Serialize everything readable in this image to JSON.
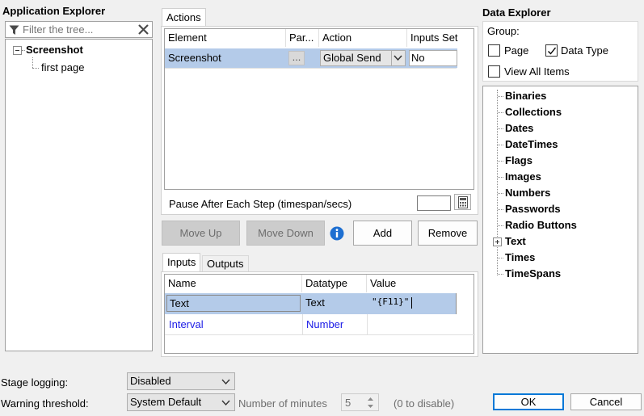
{
  "app_explorer": {
    "title": "Application Explorer",
    "filter_placeholder": "Filter the tree...",
    "tree": {
      "root": "Screenshot",
      "child": "first page"
    }
  },
  "tabs": {
    "actions": "Actions"
  },
  "actions_grid": {
    "headers": [
      "Element",
      "Par...",
      "Action",
      "Inputs Set"
    ],
    "row": {
      "element": "Screenshot",
      "params": "...",
      "action": "Global Send",
      "inputs_set": "No"
    }
  },
  "pause": {
    "label": "Pause After Each Step (timespan/secs)",
    "value": ""
  },
  "buttons": {
    "move_up": "Move Up",
    "move_down": "Move Down",
    "add": "Add",
    "remove": "Remove",
    "ok": "OK",
    "cancel": "Cancel"
  },
  "io_tabs": {
    "inputs": "Inputs",
    "outputs": "Outputs"
  },
  "inputs_grid": {
    "headers": [
      "Name",
      "Datatype",
      "Value"
    ],
    "rows": [
      {
        "name": "Text",
        "datatype": "Text",
        "value": "\"{F11}\""
      },
      {
        "name": "Interval",
        "datatype": "Number",
        "value": ""
      }
    ]
  },
  "data_explorer": {
    "title": "Data Explorer",
    "group_label": "Group:",
    "page_label": "Page",
    "page_checked": false,
    "data_type_label": "Data Type",
    "data_type_checked": true,
    "view_all_label": "View All Items",
    "view_all_checked": false,
    "items": [
      "Binaries",
      "Collections",
      "Dates",
      "DateTimes",
      "Flags",
      "Images",
      "Numbers",
      "Passwords",
      "Radio Buttons",
      "Text",
      "Times",
      "TimeSpans"
    ]
  },
  "footer": {
    "stage_logging_label": "Stage logging:",
    "stage_logging_value": "Disabled",
    "warning_threshold_label": "Warning threshold:",
    "warning_threshold_value": "System Default",
    "minutes_label": "Number of minutes",
    "minutes_value": "5",
    "disable_hint": "(0 to disable)"
  },
  "colors": {
    "selection": "#b4cbe9",
    "link_blue": "#1a1ae6",
    "info_blue": "#1e6fd1",
    "ok_border": "#0078d7"
  }
}
